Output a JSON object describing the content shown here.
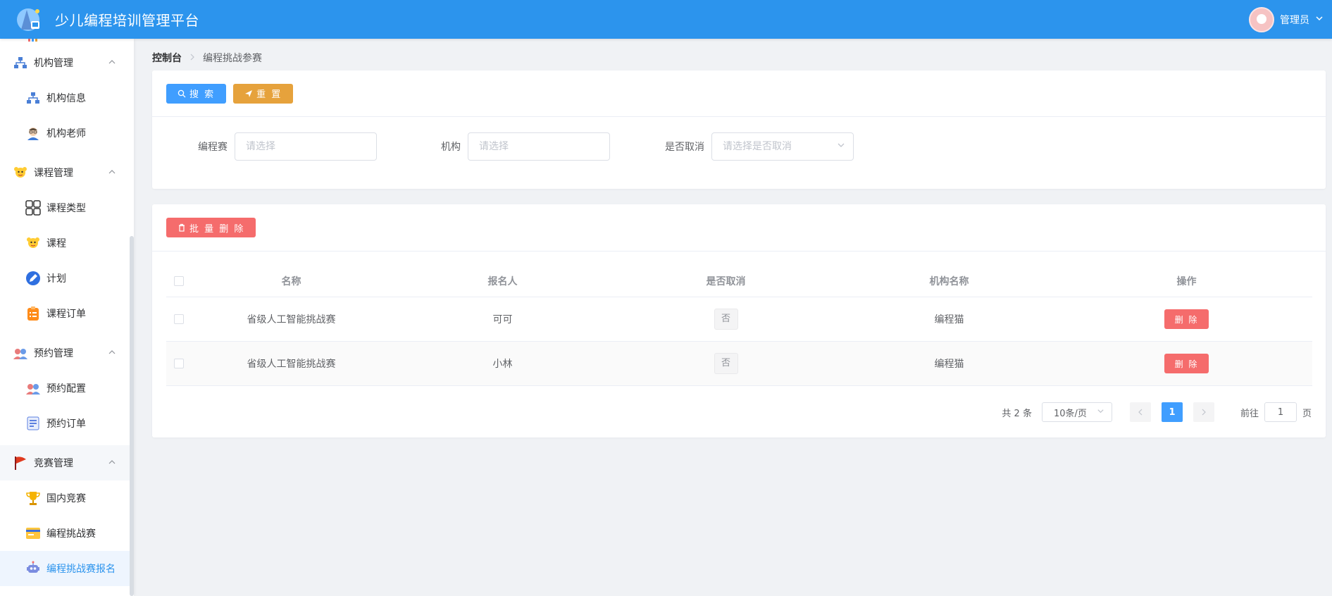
{
  "header": {
    "title": "少儿编程培训管理平台",
    "user_name": "管理员"
  },
  "sidebar": {
    "partial_top": "...",
    "items": [
      {
        "label": "机构管理",
        "type": "group",
        "icon": "org-icon"
      },
      {
        "label": "机构信息",
        "type": "sub",
        "icon": "org-icon"
      },
      {
        "label": "机构老师",
        "type": "sub",
        "icon": "teacher-icon"
      },
      {
        "label": "课程管理",
        "type": "group",
        "icon": "kid-icon"
      },
      {
        "label": "课程类型",
        "type": "sub",
        "icon": "grid-icon"
      },
      {
        "label": "课程",
        "type": "sub",
        "icon": "kid-icon"
      },
      {
        "label": "计划",
        "type": "sub",
        "icon": "pencil-icon"
      },
      {
        "label": "课程订单",
        "type": "sub",
        "icon": "clipboard-icon"
      },
      {
        "label": "预约管理",
        "type": "group",
        "icon": "people-icon"
      },
      {
        "label": "预约配置",
        "type": "sub",
        "icon": "people-icon"
      },
      {
        "label": "预约订单",
        "type": "sub",
        "icon": "doc-icon"
      },
      {
        "label": "竞赛管理",
        "type": "group",
        "icon": "flag-icon"
      },
      {
        "label": "国内竞赛",
        "type": "sub",
        "icon": "trophy-icon"
      },
      {
        "label": "编程挑战赛",
        "type": "sub",
        "icon": "card-icon"
      },
      {
        "label": "编程挑战赛报名",
        "type": "sub",
        "icon": "robot-icon",
        "active": true
      }
    ]
  },
  "breadcrumb": {
    "home": "控制台",
    "current": "编程挑战参赛"
  },
  "search": {
    "search_label": "搜 索",
    "reset_label": "重 置",
    "fields": [
      {
        "label": "编程赛",
        "placeholder": "请选择"
      },
      {
        "label": "机构",
        "placeholder": "请选择"
      },
      {
        "label": "是否取消",
        "placeholder": "请选择是否取消"
      }
    ]
  },
  "table": {
    "batch_delete_label": "批 量 删 除",
    "columns": [
      "名称",
      "报名人",
      "是否取消",
      "机构名称",
      "操作"
    ],
    "rows": [
      {
        "name": "省级人工智能挑战赛",
        "user": "可可",
        "cancel": "否",
        "org": "编程猫",
        "action": "删 除"
      },
      {
        "name": "省级人工智能挑战赛",
        "user": "小林",
        "cancel": "否",
        "org": "编程猫",
        "action": "删 除"
      }
    ]
  },
  "pager": {
    "total": "共 2 条",
    "size": "10条/页",
    "current_page": "1",
    "goto_label": "前往",
    "goto_value": "1",
    "page_unit": "页"
  },
  "colors": {
    "header": "#2c94ed",
    "primary": "#409eff",
    "warning": "#e6a23c",
    "danger": "#f56c6c",
    "active_menu_text": "#2c94ed"
  }
}
